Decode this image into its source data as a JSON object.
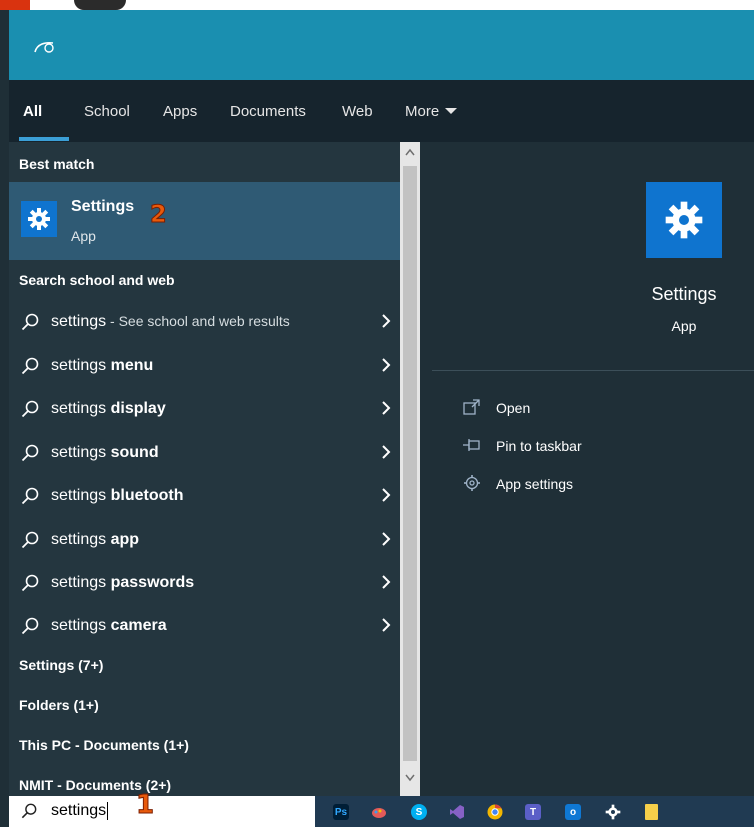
{
  "tabs": [
    {
      "label": "All"
    },
    {
      "label": "School"
    },
    {
      "label": "Apps"
    },
    {
      "label": "Documents"
    },
    {
      "label": "Web"
    },
    {
      "label": "More"
    }
  ],
  "best_match": {
    "header": "Best match",
    "title": "Settings",
    "subtitle": "App",
    "icon": "gear-icon"
  },
  "search_web": {
    "header": "Search school and web",
    "items": [
      {
        "prefix": "settings",
        "bold": "",
        "suffix": " - See school and web results"
      },
      {
        "prefix": "settings ",
        "bold": "menu",
        "suffix": ""
      },
      {
        "prefix": "settings ",
        "bold": "display",
        "suffix": ""
      },
      {
        "prefix": "settings ",
        "bold": "sound",
        "suffix": ""
      },
      {
        "prefix": "settings ",
        "bold": "bluetooth",
        "suffix": ""
      },
      {
        "prefix": "settings ",
        "bold": "app",
        "suffix": ""
      },
      {
        "prefix": "settings ",
        "bold": "passwords",
        "suffix": ""
      },
      {
        "prefix": "settings ",
        "bold": "camera",
        "suffix": ""
      }
    ]
  },
  "categories": [
    {
      "label": "Settings (7+)"
    },
    {
      "label": "Folders (1+)"
    },
    {
      "label": "This PC - Documents (1+)"
    },
    {
      "label": "NMIT - Documents (2+)"
    }
  ],
  "preview": {
    "title": "Settings",
    "subtitle": "App",
    "actions": [
      {
        "label": "Open",
        "icon": "open-icon"
      },
      {
        "label": "Pin to taskbar",
        "icon": "pin-icon"
      },
      {
        "label": "App settings",
        "icon": "gear-icon"
      }
    ]
  },
  "search": {
    "value": "settings"
  },
  "annotations": {
    "step1": "1",
    "step2": "2"
  },
  "taskbar": {
    "apps": [
      {
        "name": "Photoshop",
        "label": "Ps",
        "color": "#001e36"
      },
      {
        "name": "Paint",
        "label": "",
        "color": "#e25a5a"
      },
      {
        "name": "Skype",
        "label": "S",
        "color": "#00aff0"
      },
      {
        "name": "Visual Studio",
        "label": "",
        "color": "#8661c5"
      },
      {
        "name": "Chrome",
        "label": "",
        "color": "#f2b600"
      },
      {
        "name": "Teams",
        "label": "T",
        "color": "#5b5fc7"
      },
      {
        "name": "Outlook",
        "label": "o",
        "color": "#0f78d4"
      },
      {
        "name": "Settings",
        "label": "",
        "color": "#203a52"
      },
      {
        "name": "File Explorer",
        "label": "",
        "color": "#f6cf4a"
      }
    ]
  },
  "colors": {
    "accent": "#0f74cf",
    "header": "#1a8fb0",
    "selected": "#2f5a74",
    "badge": "#e85a0c"
  }
}
